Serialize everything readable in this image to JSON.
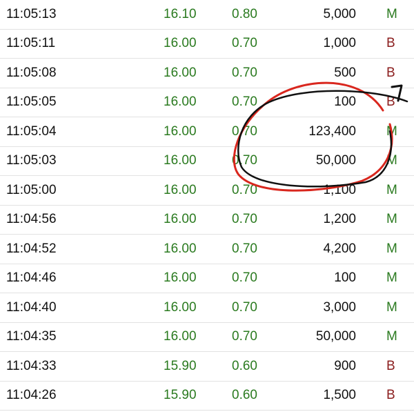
{
  "colors": {
    "up": "#2a7a1f",
    "sell": "#8a1c1c",
    "text": "#111111",
    "divider": "#e2e2e2",
    "red_annotation": "#d9271e",
    "black_annotation": "#111111"
  },
  "trades": [
    {
      "time": "11:05:13",
      "price": "16.10",
      "change": "0.80",
      "volume": "5,000",
      "side": "M"
    },
    {
      "time": "11:05:11",
      "price": "16.00",
      "change": "0.70",
      "volume": "1,000",
      "side": "B"
    },
    {
      "time": "11:05:08",
      "price": "16.00",
      "change": "0.70",
      "volume": "500",
      "side": "B"
    },
    {
      "time": "11:05:05",
      "price": "16.00",
      "change": "0.70",
      "volume": "100",
      "side": "B"
    },
    {
      "time": "11:05:04",
      "price": "16.00",
      "change": "0.70",
      "volume": "123,400",
      "side": "M"
    },
    {
      "time": "11:05:03",
      "price": "16.00",
      "change": "0.70",
      "volume": "50,000",
      "side": "M"
    },
    {
      "time": "11:05:00",
      "price": "16.00",
      "change": "0.70",
      "volume": "1,100",
      "side": "M"
    },
    {
      "time": "11:04:56",
      "price": "16.00",
      "change": "0.70",
      "volume": "1,200",
      "side": "M"
    },
    {
      "time": "11:04:52",
      "price": "16.00",
      "change": "0.70",
      "volume": "4,200",
      "side": "M"
    },
    {
      "time": "11:04:46",
      "price": "16.00",
      "change": "0.70",
      "volume": "100",
      "side": "M"
    },
    {
      "time": "11:04:40",
      "price": "16.00",
      "change": "0.70",
      "volume": "3,000",
      "side": "M"
    },
    {
      "time": "11:04:35",
      "price": "16.00",
      "change": "0.70",
      "volume": "50,000",
      "side": "M"
    },
    {
      "time": "11:04:33",
      "price": "15.90",
      "change": "0.60",
      "volume": "900",
      "side": "B"
    },
    {
      "time": "11:04:26",
      "price": "15.90",
      "change": "0.60",
      "volume": "1,500",
      "side": "B"
    }
  ]
}
